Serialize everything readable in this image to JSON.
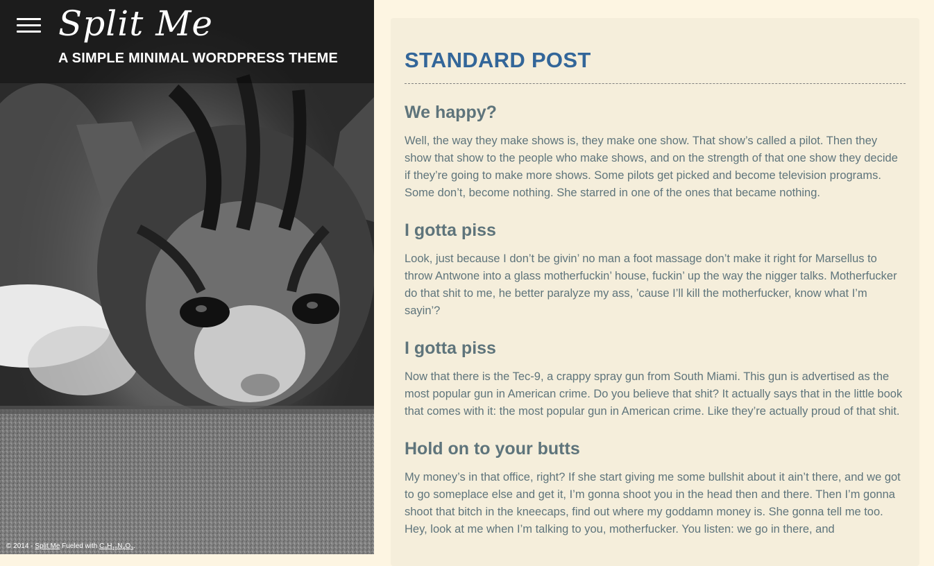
{
  "site": {
    "title": "Split Me",
    "tagline": "A SIMPLE MINIMAL WORDPRESS THEME"
  },
  "footer": {
    "copyright": "© 2014 - ",
    "link_text": "Split Me",
    "fueled_text": " Fueled with ",
    "formula_c": "C",
    "formula_c_sub": "8",
    "formula_h": "H",
    "formula_h_sub": "10",
    "formula_n": "N",
    "formula_n_sub": "4",
    "formula_o": "O",
    "formula_o_sub": "2",
    "period": "."
  },
  "post": {
    "title": "STANDARD POST",
    "sections": [
      {
        "heading": "We happy?",
        "body": "Well, the way they make shows is, they make one show. That show’s called a pilot. Then they show that show to the people who make shows, and on the strength of that one show they decide if they’re going to make more shows. Some pilots get picked and become television programs. Some don’t, become nothing. She starred in one of the ones that became nothing."
      },
      {
        "heading": "I gotta piss",
        "body": "Look, just because I don’t be givin’ no man a foot massage don’t make it right for Marsellus to throw Antwone into a glass motherfuckin’ house, fuckin’ up the way the nigger talks. Motherfucker do that shit to me, he better paralyze my ass, ’cause I’ll kill the motherfucker, know what I’m sayin’?"
      },
      {
        "heading": "I gotta piss",
        "body": "Now that there is the Tec-9, a crappy spray gun from South Miami. This gun is advertised as the most popular gun in American crime. Do you believe that shit? It actually says that in the little book that comes with it: the most popular gun in American crime. Like they’re actually proud of that shit."
      },
      {
        "heading": "Hold on to your butts",
        "body": "My money’s in that office, right? If she start giving me some bullshit about it ain’t there, and we got to go someplace else and get it, I’m gonna shoot you in the head then and there. Then I’m gonna shoot that bitch in the kneecaps, find out where my goddamn money is. She gonna tell me too. Hey, look at me when I’m talking to you, motherfucker. You listen: we go in there, and"
      }
    ]
  },
  "colors": {
    "page_background": "#fdf5e2",
    "card_background": "#f5eedb",
    "title_color": "#336699",
    "text_color": "#5e747b"
  },
  "icons": {
    "menu": "hamburger-icon"
  }
}
